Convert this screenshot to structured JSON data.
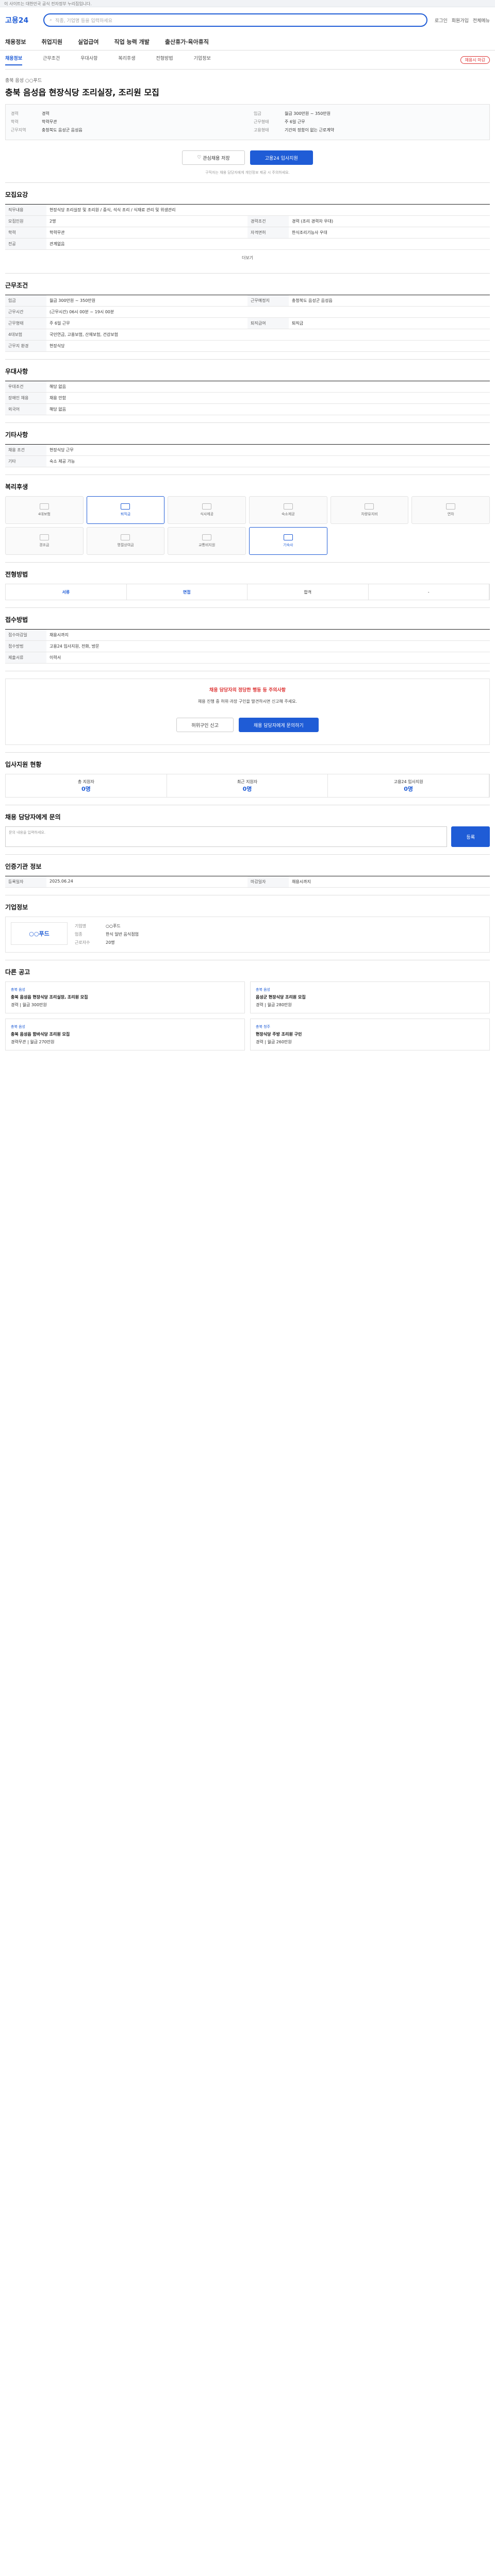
{
  "topbar": {
    "text": "이 사이트는 대한민국 공식 전자정부 누리집입니다."
  },
  "header": {
    "logo": "고용24",
    "search_placeholder": "직종, 기업명 등을 입력하세요",
    "links": [
      "로그인",
      "회원가입",
      "전체메뉴"
    ]
  },
  "gnb": {
    "items": [
      "채용정보",
      "취업지원",
      "실업급여",
      "직업 능력 개발",
      "출산휴가·육아휴직"
    ]
  },
  "subnav": {
    "tabs": [
      "채용정보",
      "근무조건",
      "우대사항",
      "복리후생",
      "전형방법",
      "기업정보"
    ],
    "badge": "채용시 마감"
  },
  "job": {
    "company": "충북 음성 ○○푸드",
    "title": "충북 음성읍 현장식당 조리실장, 조리원 모집"
  },
  "summary": {
    "left": [
      {
        "k": "경력",
        "v": "경력"
      },
      {
        "k": "학력",
        "v": "학력무관"
      },
      {
        "k": "근무지역",
        "v": "충청북도 음성군 음성읍"
      }
    ],
    "right": [
      {
        "k": "임금",
        "v": "월급 300만원 ~ 350만원"
      },
      {
        "k": "근무형태",
        "v": "주 6일 근무"
      },
      {
        "k": "고용형태",
        "v": "기간의 정함이 없는 근로계약"
      }
    ]
  },
  "actions": {
    "save": "관심채용 저장",
    "apply": "고용24 입사지원"
  },
  "apply_note": "구직자는 채용 담당자에게 개인정보 제공 시 주의하세요.",
  "recruit": {
    "title": "모집요강",
    "rows": [
      {
        "k": "직무내용",
        "v": "현장식당 조리실장 및 조리원 / 중식, 석식 조리 / 식재료 관리 및 위생관리"
      },
      {
        "k": "모집인원",
        "v": "2명"
      },
      {
        "k": "경력조건",
        "v": "경력 (조리 경력자 우대)"
      },
      {
        "k": "학력",
        "v": "학력무관"
      },
      {
        "k": "자격면허",
        "v": "한식조리기능사 우대"
      },
      {
        "k": "전공",
        "v": "관계없음"
      }
    ]
  },
  "conditions": {
    "title": "근무조건",
    "rows": [
      {
        "k": "임금",
        "v": "월급 300만원 ~ 350만원"
      },
      {
        "k": "근무예정지",
        "v": "충청북도 음성군 음성읍"
      },
      {
        "k": "근무시간",
        "v": "(근무시간) 06시 00분 ~ 19시 00분"
      },
      {
        "k": "근무형태",
        "v": "주 6일 근무"
      },
      {
        "k": "4대보험",
        "v": "국민연금, 고용보험, 산재보험, 건강보험"
      },
      {
        "k": "퇴직급여",
        "v": "퇴직금"
      },
      {
        "k": "근무지 환경",
        "v": "현장식당"
      }
    ]
  },
  "preferences": {
    "title": "우대사항",
    "rows": [
      {
        "k": "우대조건",
        "v": "해당 없음"
      },
      {
        "k": "장애인 채용",
        "v": "채용 안함"
      },
      {
        "k": "외국어",
        "v": "해당 없음"
      }
    ]
  },
  "misc": {
    "title": "기타사항",
    "rows": [
      {
        "k": "채용 조건",
        "v": "현장식당 근무"
      },
      {
        "k": "기타",
        "v": "숙소 제공 가능"
      }
    ]
  },
  "welfare": {
    "title": "복리후생",
    "items": [
      "4대보험",
      "퇴직금",
      "식사제공",
      "숙소제공",
      "차량유지비",
      "연차",
      "경조금",
      "명절상여금",
      "교통비지원",
      "기숙사"
    ]
  },
  "process": {
    "title": "전형방법",
    "steps": [
      "서류",
      "면접",
      "합격",
      "-"
    ]
  },
  "apply_method": {
    "title": "접수방법",
    "rows": [
      {
        "k": "접수마감일",
        "v": "채용시까지"
      },
      {
        "k": "접수방법",
        "v": "고용24 입사지원, 전화, 방문"
      },
      {
        "k": "제출서류",
        "v": "이력서"
      }
    ]
  },
  "notice": {
    "alert": "채용 담당자의 정당한 행동 등 주의사항",
    "text": "채용 진행 중 허위·과장 구인을 발견하시면 신고해 주세요.",
    "btn1": "허위구인 신고",
    "btn2": "채용 담당자에게 문의하기"
  },
  "stats": {
    "title": "입사지원 현황",
    "items": [
      {
        "label": "총 지원자",
        "value": "0명"
      },
      {
        "label": "최근 지원자",
        "value": "0명"
      },
      {
        "label": "고용24 입사지원",
        "value": "0명"
      }
    ]
  },
  "inquiry": {
    "title": "채용 담당자에게 문의",
    "placeholder": "문의 내용을 입력하세요.",
    "button": "등록"
  },
  "info": {
    "title": "인증기관 정보",
    "rows": [
      {
        "k": "등록일자",
        "v": "2025.06.24"
      },
      {
        "k": "마감일자",
        "v": "채용시까지"
      }
    ]
  },
  "company": {
    "title": "기업정보",
    "name": "○○푸드",
    "rows": [
      {
        "k": "기업명",
        "v": "○○푸드"
      },
      {
        "k": "업종",
        "v": "한식 일반 음식점업"
      },
      {
        "k": "근로자수",
        "v": "20명"
      }
    ]
  },
  "similar": {
    "title": "다른 공고",
    "cards": [
      {
        "company": "충북 음성",
        "title": "충북 음성읍 현장식당 조리실장, 조리원 모집",
        "cond": "경력 | 월급 300만원"
      },
      {
        "company": "충북 음성",
        "title": "음성군 현장식당 조리원 모집",
        "cond": "경력 | 월급 280만원"
      },
      {
        "company": "충북 음성",
        "title": "충북 음성읍 함바식당 조리원 모집",
        "cond": "경력무관 | 월급 270만원"
      },
      {
        "company": "충북 청주",
        "title": "현장식당 주방 조리원 구인",
        "cond": "경력 | 월급 260만원"
      }
    ]
  },
  "more_label": "더보기"
}
